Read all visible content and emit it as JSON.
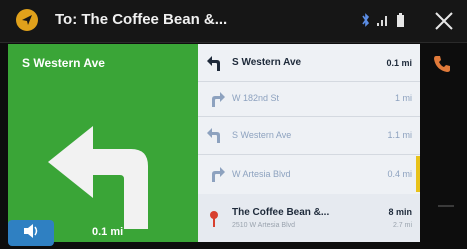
{
  "topbar": {
    "title": "To: The Coffee Bean &...",
    "nav_icon": "navigation-icon",
    "status_icons": [
      "bluetooth-icon",
      "signal-icon",
      "battery-icon"
    ],
    "close_icon": "close-icon"
  },
  "maneuver": {
    "street": "S Western Ave",
    "distance": "0.1 mi",
    "arrow_icon": "turn-left-arrow-icon",
    "sound_icon": "speaker-icon"
  },
  "directions": [
    {
      "icon": "turn-left-icon",
      "label": "S Western Ave",
      "distance": "0.1 mi",
      "active": true
    },
    {
      "icon": "turn-right-icon",
      "label": "W 182nd St",
      "distance": "1 mi",
      "active": false
    },
    {
      "icon": "turn-left-icon",
      "label": "S Western Ave",
      "distance": "1.1 mi",
      "active": false
    },
    {
      "icon": "turn-right-icon",
      "label": "W Artesia Blvd",
      "distance": "0.4 mi",
      "active": false
    }
  ],
  "destination": {
    "icon": "destination-pin-icon",
    "name": "The Coffee Bean &...",
    "address": "2510 W Artesia Blvd",
    "time": "8 min",
    "distance": "2.7 mi"
  },
  "side": {
    "phone_icon": "phone-icon"
  },
  "colors": {
    "maneuver_green": "#3aa537",
    "accent_yellow": "#e0a11b",
    "sound_blue": "#2f80c2"
  }
}
